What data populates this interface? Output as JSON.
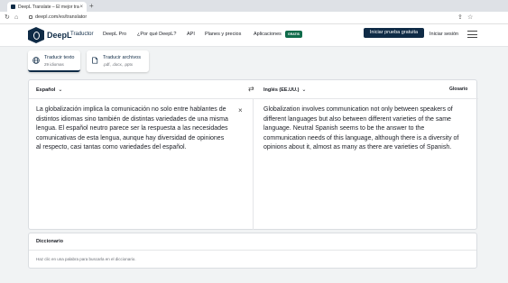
{
  "browser": {
    "tab_title": "DeepL Translate – El mejor trad",
    "tab_close": "×",
    "new_tab": "+",
    "url": "deepl.com/es/translator"
  },
  "header": {
    "brand": "DeepL",
    "brand_sub": "Traductor",
    "nav": [
      "DeepL Pro",
      "¿Por qué DeepL?",
      "API",
      "Planes y precios",
      "Aplicaciones"
    ],
    "badge": "GRATIS",
    "cta": "Iniciar prueba gratuita",
    "login": "Iniciar sesión"
  },
  "modes": [
    {
      "title": "Traducir texto",
      "subtitle": "29 idiomas"
    },
    {
      "title": "Traducir archivos",
      "subtitle": ".pdf, .docx, .pptx"
    }
  ],
  "translator": {
    "source_lang": "Español",
    "target_lang": "Inglés (EE.UU.)",
    "glossary": "Glosario",
    "source_text": "La globalización implica la comunicación no solo entre hablantes de distintos idiomas sino también de distintas variedades de una misma lengua. El español neutro parece ser la respuesta a las necesidades comunicativas de esta lengua, aunque hay diversidad de opiniones al respecto, casi tantas como variedades del español.",
    "target_text": "Globalization involves communication not only between speakers of different languages but also between different varieties of the same language. Neutral Spanish seems to be the answer to the communication needs of this language, although there is a diversity of opinions about it, almost as many as there are varieties of Spanish."
  },
  "dictionary": {
    "title": "Diccionario",
    "hint": "Haz clic en una palabra para buscarla en el diccionario."
  },
  "colors": {
    "brand": "#0f2b46",
    "badge": "#0f6b4a"
  }
}
